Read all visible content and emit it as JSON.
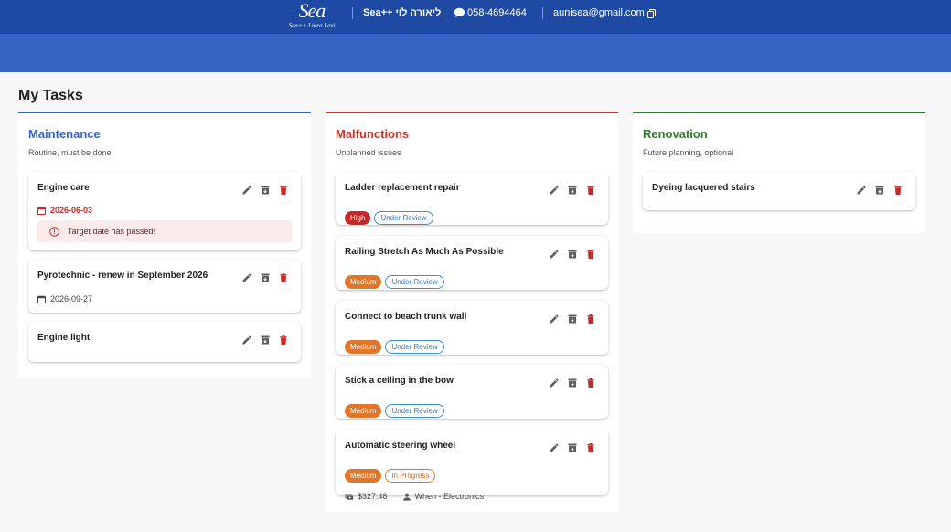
{
  "header": {
    "logo_text": "Sea",
    "logo_sub": "Sea++ Liora Levi",
    "brand": "ליאורה לוי ++Sea",
    "phone": "058-4694464",
    "email": "aunisea@gmail.com"
  },
  "page": {
    "title": "My Tasks"
  },
  "colors": {
    "header": "#1f4aa3",
    "subbar": "#3464c4",
    "maintenance": "#3464c4",
    "malfunctions": "#c9352f",
    "renovation": "#2f7a32",
    "high": "#c62828",
    "medium": "#e0762a",
    "under_review": "#2d7bc4"
  },
  "columns": [
    {
      "title": "Maintenance",
      "subtitle": "Routine, must be done",
      "cards": [
        {
          "title": "Engine care",
          "date": "2026-06-03",
          "alert": "Target date has passed!"
        },
        {
          "title": "Pyrotechnic - renew in September 2026",
          "date": "2026-09-27"
        },
        {
          "title": "Engine light"
        }
      ]
    },
    {
      "title": "Malfunctions",
      "subtitle": "Unplanned issues",
      "cards": [
        {
          "title": "Ladder replacement repair",
          "priority": "High",
          "status": "Under Review"
        },
        {
          "title": "Railing Stretch As Much As Possible",
          "priority": "Medium",
          "status": "Under Review"
        },
        {
          "title": "Connect to beach trunk wall",
          "priority": "Medium",
          "status": "Under Review"
        },
        {
          "title": "Stick a ceiling in the bow",
          "priority": "Medium",
          "status": "Under Review"
        },
        {
          "title": "Automatic steering wheel",
          "priority": "Medium",
          "status": "In Progress",
          "cost": "$327.48",
          "assignee": "When - Electronics"
        }
      ]
    },
    {
      "title": "Renovation",
      "subtitle": "Future planning, optional",
      "cards": [
        {
          "title": "Dyeing lacquered stairs"
        }
      ]
    }
  ],
  "icons": {
    "edit": "pencil-icon",
    "archive": "archive-icon",
    "delete": "trash-icon",
    "date": "calendar-icon",
    "alert": "error-outline-icon",
    "phone": "chat-bubble-icon",
    "copy": "copy-icon",
    "cost": "money-icon",
    "assignee": "person-icon"
  }
}
